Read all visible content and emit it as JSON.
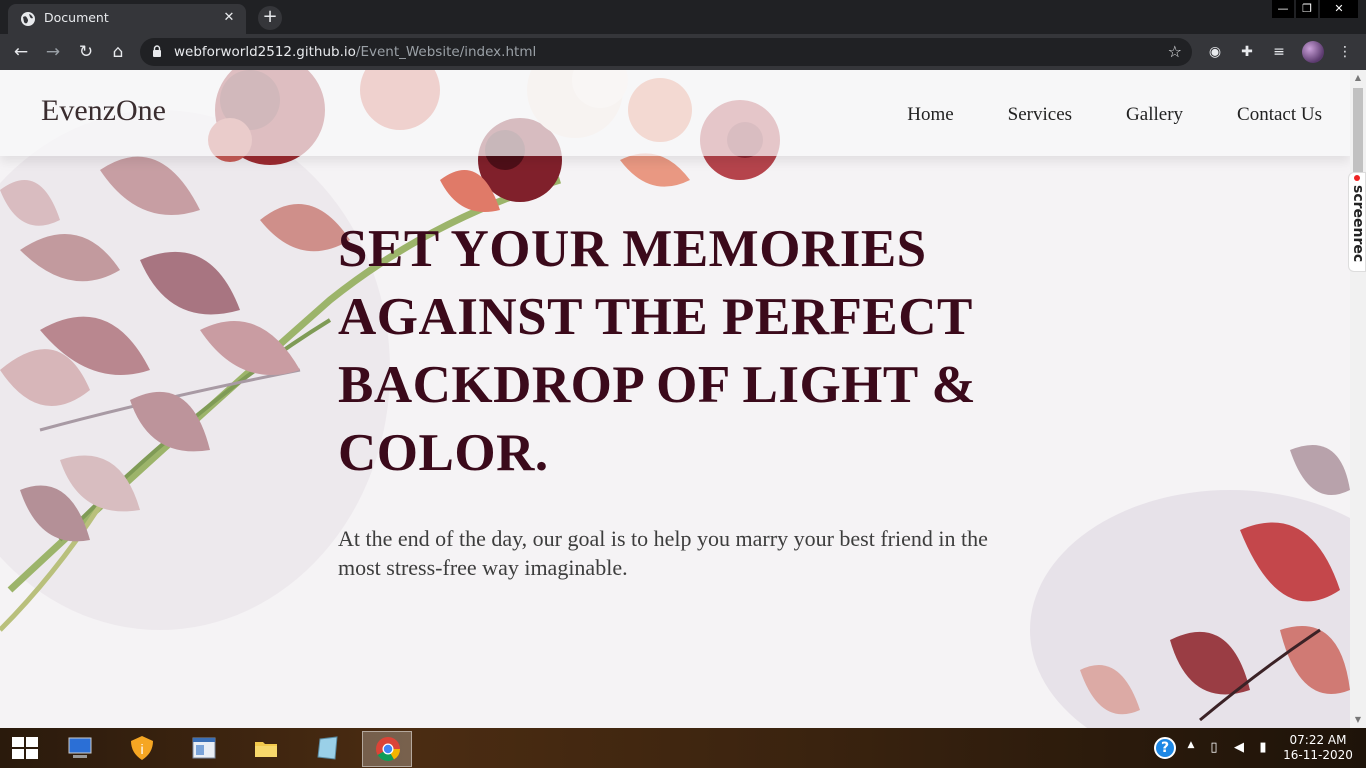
{
  "browser": {
    "tab_title": "Document",
    "tab_close": "✕",
    "new_tab": "+",
    "url_host": "webforworld2512.github.io",
    "url_path": "/Event_Website/index.html",
    "window_controls": {
      "minimize": "—",
      "restore": "❐",
      "close": "✕"
    }
  },
  "site": {
    "brand": "EvenzOne",
    "nav": [
      "Home",
      "Services",
      "Gallery",
      "Contact Us"
    ],
    "hero_title": "SET YOUR MEMORIES AGAINST THE PERFECT BACKDROP OF LIGHT & COLOR.",
    "hero_subtitle": "At the end of the day, our goal is to help you marry your best friend in the most stress-free way imaginable."
  },
  "overlay": {
    "screenrec_label": "screenrec"
  },
  "taskbar": {
    "time": "07:22 AM",
    "date": "16-11-2020",
    "help": "?"
  },
  "colors": {
    "hero_title": "#3b0a1b",
    "browser_chrome": "#35363a",
    "tabstrip": "#202124"
  }
}
